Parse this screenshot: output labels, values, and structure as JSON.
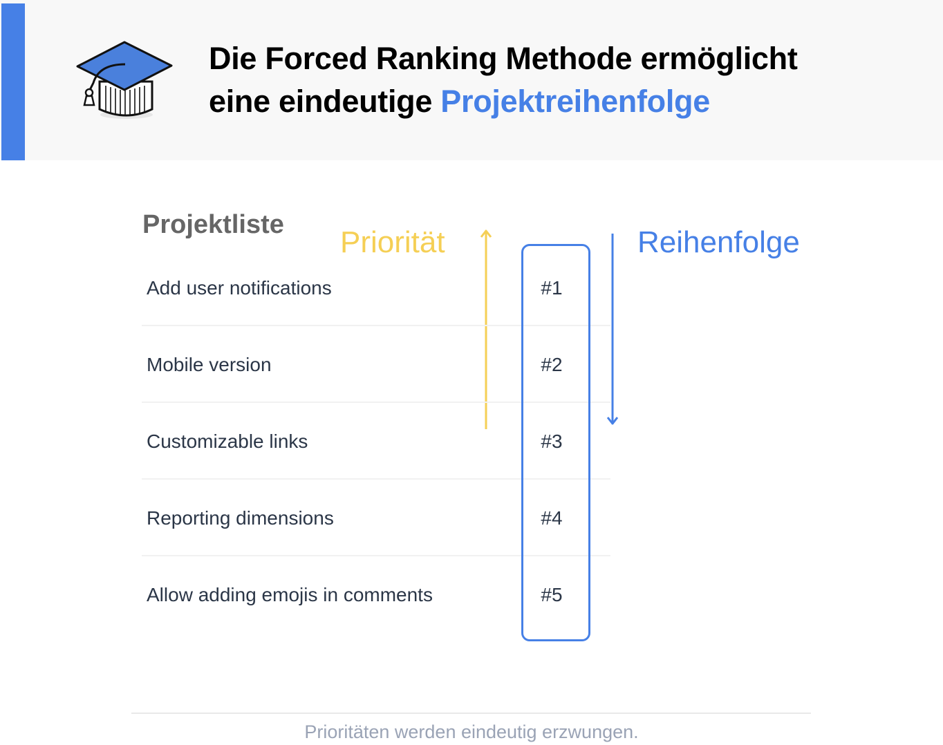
{
  "header": {
    "icon": "graduation-cap-icon",
    "title_line1": "Die Forced Ranking Methode ermöglicht",
    "title_line2_prefix": "eine eindeutige ",
    "title_line2_highlight": "Projektreihenfolge"
  },
  "diagram": {
    "list_title": "Projektliste",
    "priority_label": "Priorität",
    "order_label": "Reihenfolge",
    "items": [
      {
        "name": "Add user notifications",
        "rank": "#1"
      },
      {
        "name": "Mobile version",
        "rank": "#2"
      },
      {
        "name": "Customizable links",
        "rank": "#3"
      },
      {
        "name": "Reporting dimensions",
        "rank": "#4"
      },
      {
        "name": "Allow adding emojis in comments",
        "rank": "#5"
      }
    ]
  },
  "footer": {
    "caption": "Prioritäten werden eindeutig erzwungen."
  },
  "colors": {
    "accent_blue": "#4680e6",
    "priority_yellow": "#f5cf55",
    "text_dark": "#2b3647",
    "heading_gray": "#666666",
    "caption_gray": "#9aa3b5",
    "header_bg": "#f8f8f8"
  }
}
